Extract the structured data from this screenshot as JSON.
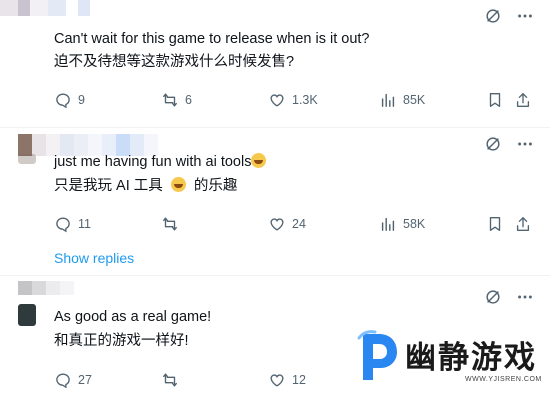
{
  "posts": [
    {
      "lines": [
        "Can't wait for this game to release when is it out?",
        "迫不及待想等这款游戏什么时候发售?"
      ],
      "stats": {
        "replies": "9",
        "reposts": "6",
        "likes": "1.3K",
        "views": "85K"
      }
    },
    {
      "lines": [
        "just me having fun with ai tools",
        "只是我玩 AI 工具",
        "的乐趣"
      ],
      "stats": {
        "replies": "11",
        "reposts": "",
        "likes": "24",
        "views": "58K"
      },
      "show_replies": "Show replies"
    },
    {
      "lines": [
        "As good as a real game!",
        "和真正的游戏一样好!"
      ],
      "stats": {
        "replies": "27",
        "reposts": "",
        "likes": "12"
      }
    }
  ],
  "watermark": {
    "brand": "幽静游戏",
    "url": "WWW.YJISREN.COM"
  },
  "colors": {
    "accent": "#1d9bf0",
    "muted": "#536471",
    "text": "#0f1419",
    "divider": "#eff3f4"
  }
}
